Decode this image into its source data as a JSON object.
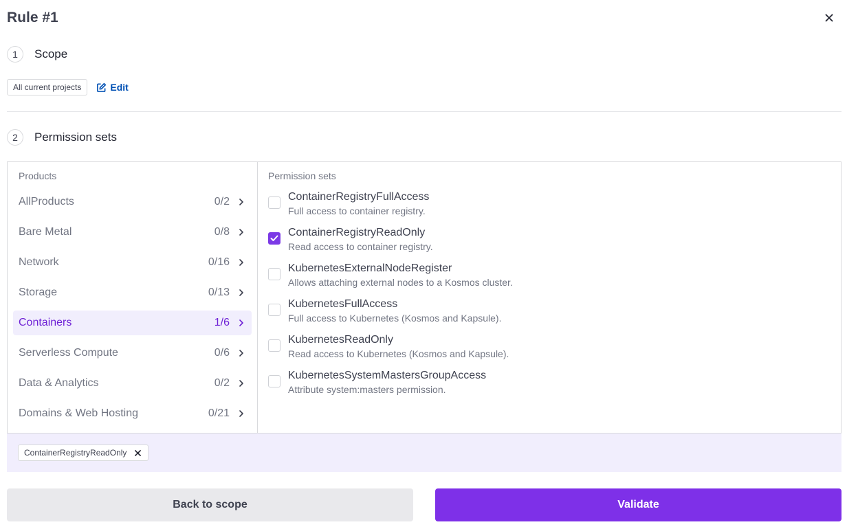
{
  "dialog": {
    "title": "Rule #1"
  },
  "steps": [
    {
      "number": "1",
      "label": "Scope"
    },
    {
      "number": "2",
      "label": "Permission sets"
    }
  ],
  "scope": {
    "tag": "All current projects",
    "edit_label": "Edit"
  },
  "products": {
    "header": "Products",
    "items": [
      {
        "name": "AllProducts",
        "count": "0/2"
      },
      {
        "name": "Bare Metal",
        "count": "0/8"
      },
      {
        "name": "Network",
        "count": "0/16"
      },
      {
        "name": "Storage",
        "count": "0/13"
      },
      {
        "name": "Containers",
        "count": "1/6",
        "active": true
      },
      {
        "name": "Serverless Compute",
        "count": "0/6"
      },
      {
        "name": "Data & Analytics",
        "count": "0/2"
      },
      {
        "name": "Domains & Web Hosting",
        "count": "0/21"
      }
    ]
  },
  "permission_sets": {
    "header": "Permission sets",
    "items": [
      {
        "name": "ContainerRegistryFullAccess",
        "description": "Full access to container registry.",
        "checked": false
      },
      {
        "name": "ContainerRegistryReadOnly",
        "description": "Read access to container registry.",
        "checked": true
      },
      {
        "name": "KubernetesExternalNodeRegister",
        "description": "Allows attaching external nodes to a Kosmos cluster.",
        "checked": false
      },
      {
        "name": "KubernetesFullAccess",
        "description": "Full access to Kubernetes (Kosmos and Kapsule).",
        "checked": false
      },
      {
        "name": "KubernetesReadOnly",
        "description": "Read access to Kubernetes (Kosmos and Kapsule).",
        "checked": false
      },
      {
        "name": "KubernetesSystemMastersGroupAccess",
        "description": "Attribute system:masters permission.",
        "checked": false
      }
    ]
  },
  "selected": {
    "chips": [
      "ContainerRegistryReadOnly"
    ]
  },
  "footer": {
    "back_label": "Back to scope",
    "validate_label": "Validate"
  },
  "colors": {
    "accent": "#7e30e8",
    "active_bg": "#f1eefd",
    "link": "#0050b4"
  },
  "icons": {
    "close": "close-icon",
    "edit": "edit-icon",
    "chevron": "chevron-right-icon",
    "check": "check-icon",
    "chip_remove": "close-icon"
  }
}
